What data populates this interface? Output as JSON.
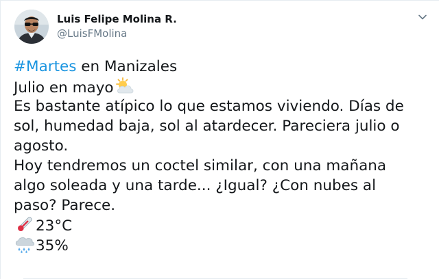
{
  "tweet": {
    "author_name": "Luis Felipe Molina R.",
    "author_handle": "@LuisFMolina",
    "hashtag": "#Martes",
    "line1_rest": " en Manizales",
    "line2": "Julio en mayo",
    "line3": "Es bastante atípico lo que estamos viviendo. Días de",
    "line4": "sol, humedad baja, sol al atardecer. Pareciera julio o",
    "line5": "agosto.",
    "line6": "Hoy tendremos un coctel similar, con una mañana",
    "line7": "algo soleada y una tarde... ¿Igual? ¿Con nubes al",
    "line8": "paso? Parece.",
    "temperature": "23°C",
    "rain_chance": "35%"
  },
  "icons": {
    "menu": "chevron-down-icon",
    "weather": "sun-behind-cloud-icon",
    "temperature": "thermometer-icon",
    "rain": "cloud-with-rain-icon"
  },
  "colors": {
    "hashtag": "#1b95e0",
    "text": "#14171a",
    "secondary": "#657786"
  }
}
